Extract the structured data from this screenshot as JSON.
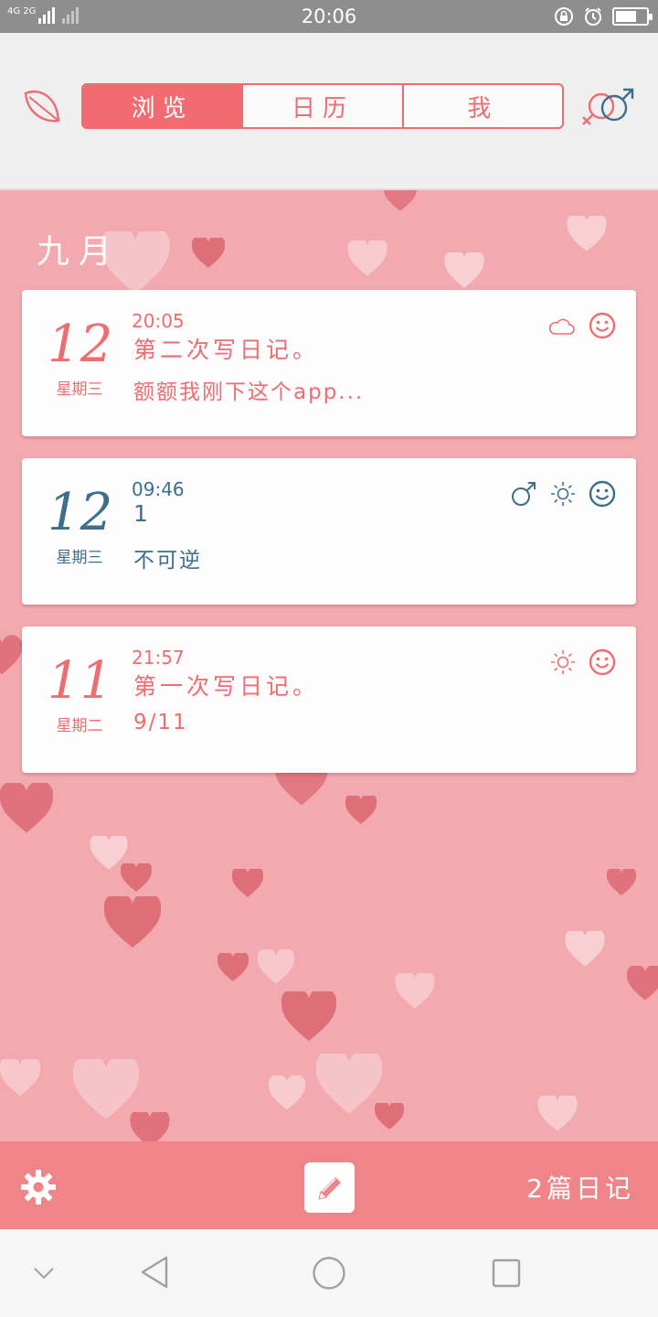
{
  "status_bar": {
    "network": "4G 2G",
    "time": "20:06"
  },
  "header": {
    "tabs": [
      {
        "label": "浏览",
        "active": true
      },
      {
        "label": "日历",
        "active": false
      },
      {
        "label": "我",
        "active": false
      }
    ]
  },
  "month": "九月",
  "entries": [
    {
      "day": "12",
      "weekday": "星期三",
      "time": "20:05",
      "title": "第二次写日记。",
      "body": "额额我刚下这个app...",
      "color": "#ef6c70",
      "icons": [
        "cloud-icon",
        "smile-icon"
      ]
    },
    {
      "day": "12",
      "weekday": "星期三",
      "time": "09:46",
      "title": "1",
      "body": "不可逆",
      "color": "#3d6e8c",
      "icons": [
        "male-icon",
        "sun-icon",
        "smile-icon"
      ]
    },
    {
      "day": "11",
      "weekday": "星期二",
      "time": "21:57",
      "title": "第一次写日记。",
      "body": "9/11",
      "color": "#ef6c70",
      "icons": [
        "sun-icon",
        "smile-icon"
      ]
    }
  ],
  "toolbar": {
    "count_label": "2篇日记"
  },
  "colors": {
    "accent": "#ef6c70",
    "secondary": "#3d6e8c",
    "background": "#f3a9b0",
    "toolbar": "#ef8589"
  }
}
